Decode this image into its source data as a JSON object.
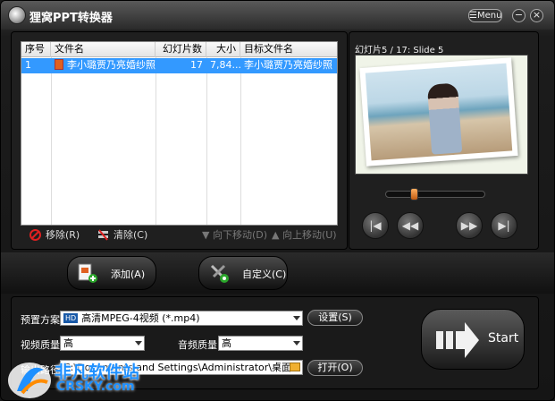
{
  "window": {
    "title": "狸窝PPT转换器",
    "menu_label": "Menu",
    "minimize": "−",
    "close": "×"
  },
  "table": {
    "headers": [
      "序号",
      "文件名",
      "幻灯片数",
      "大小",
      "目标文件名"
    ],
    "rows": [
      {
        "index": "1",
        "filename": "李小璐贾乃亮婚纱照",
        "slides": "17",
        "size": "7,84...",
        "target": "李小璐贾乃亮婚纱照"
      }
    ]
  },
  "actions": {
    "remove": "移除(R)",
    "clear": "清除(C)",
    "move_down": "向下移动(D)",
    "move_up": "向上移动(U)"
  },
  "preview": {
    "slide_label": "幻灯片5 / 17: Slide 5",
    "seek_progress": 0.2
  },
  "buttons": {
    "add": "添加(A)",
    "customize": "自定义(C)"
  },
  "settings": {
    "preset_label": "预置方案:",
    "preset_value": "高清MPEG-4视频 (*.mp4)",
    "preset_badge": "HD",
    "settings_button": "设置(S)",
    "video_quality_label": "视频质量:",
    "video_quality_value": "高",
    "audio_quality_label": "音频质量:",
    "audio_quality_value": "高",
    "output_label": "输出路径:",
    "output_value": "C:\\Documents and Settings\\Administrator\\桌面",
    "open_button": "打开(O)"
  },
  "start_label": "Start",
  "watermark": {
    "text": "非凡软件站",
    "sub": "CRSKY.com"
  }
}
